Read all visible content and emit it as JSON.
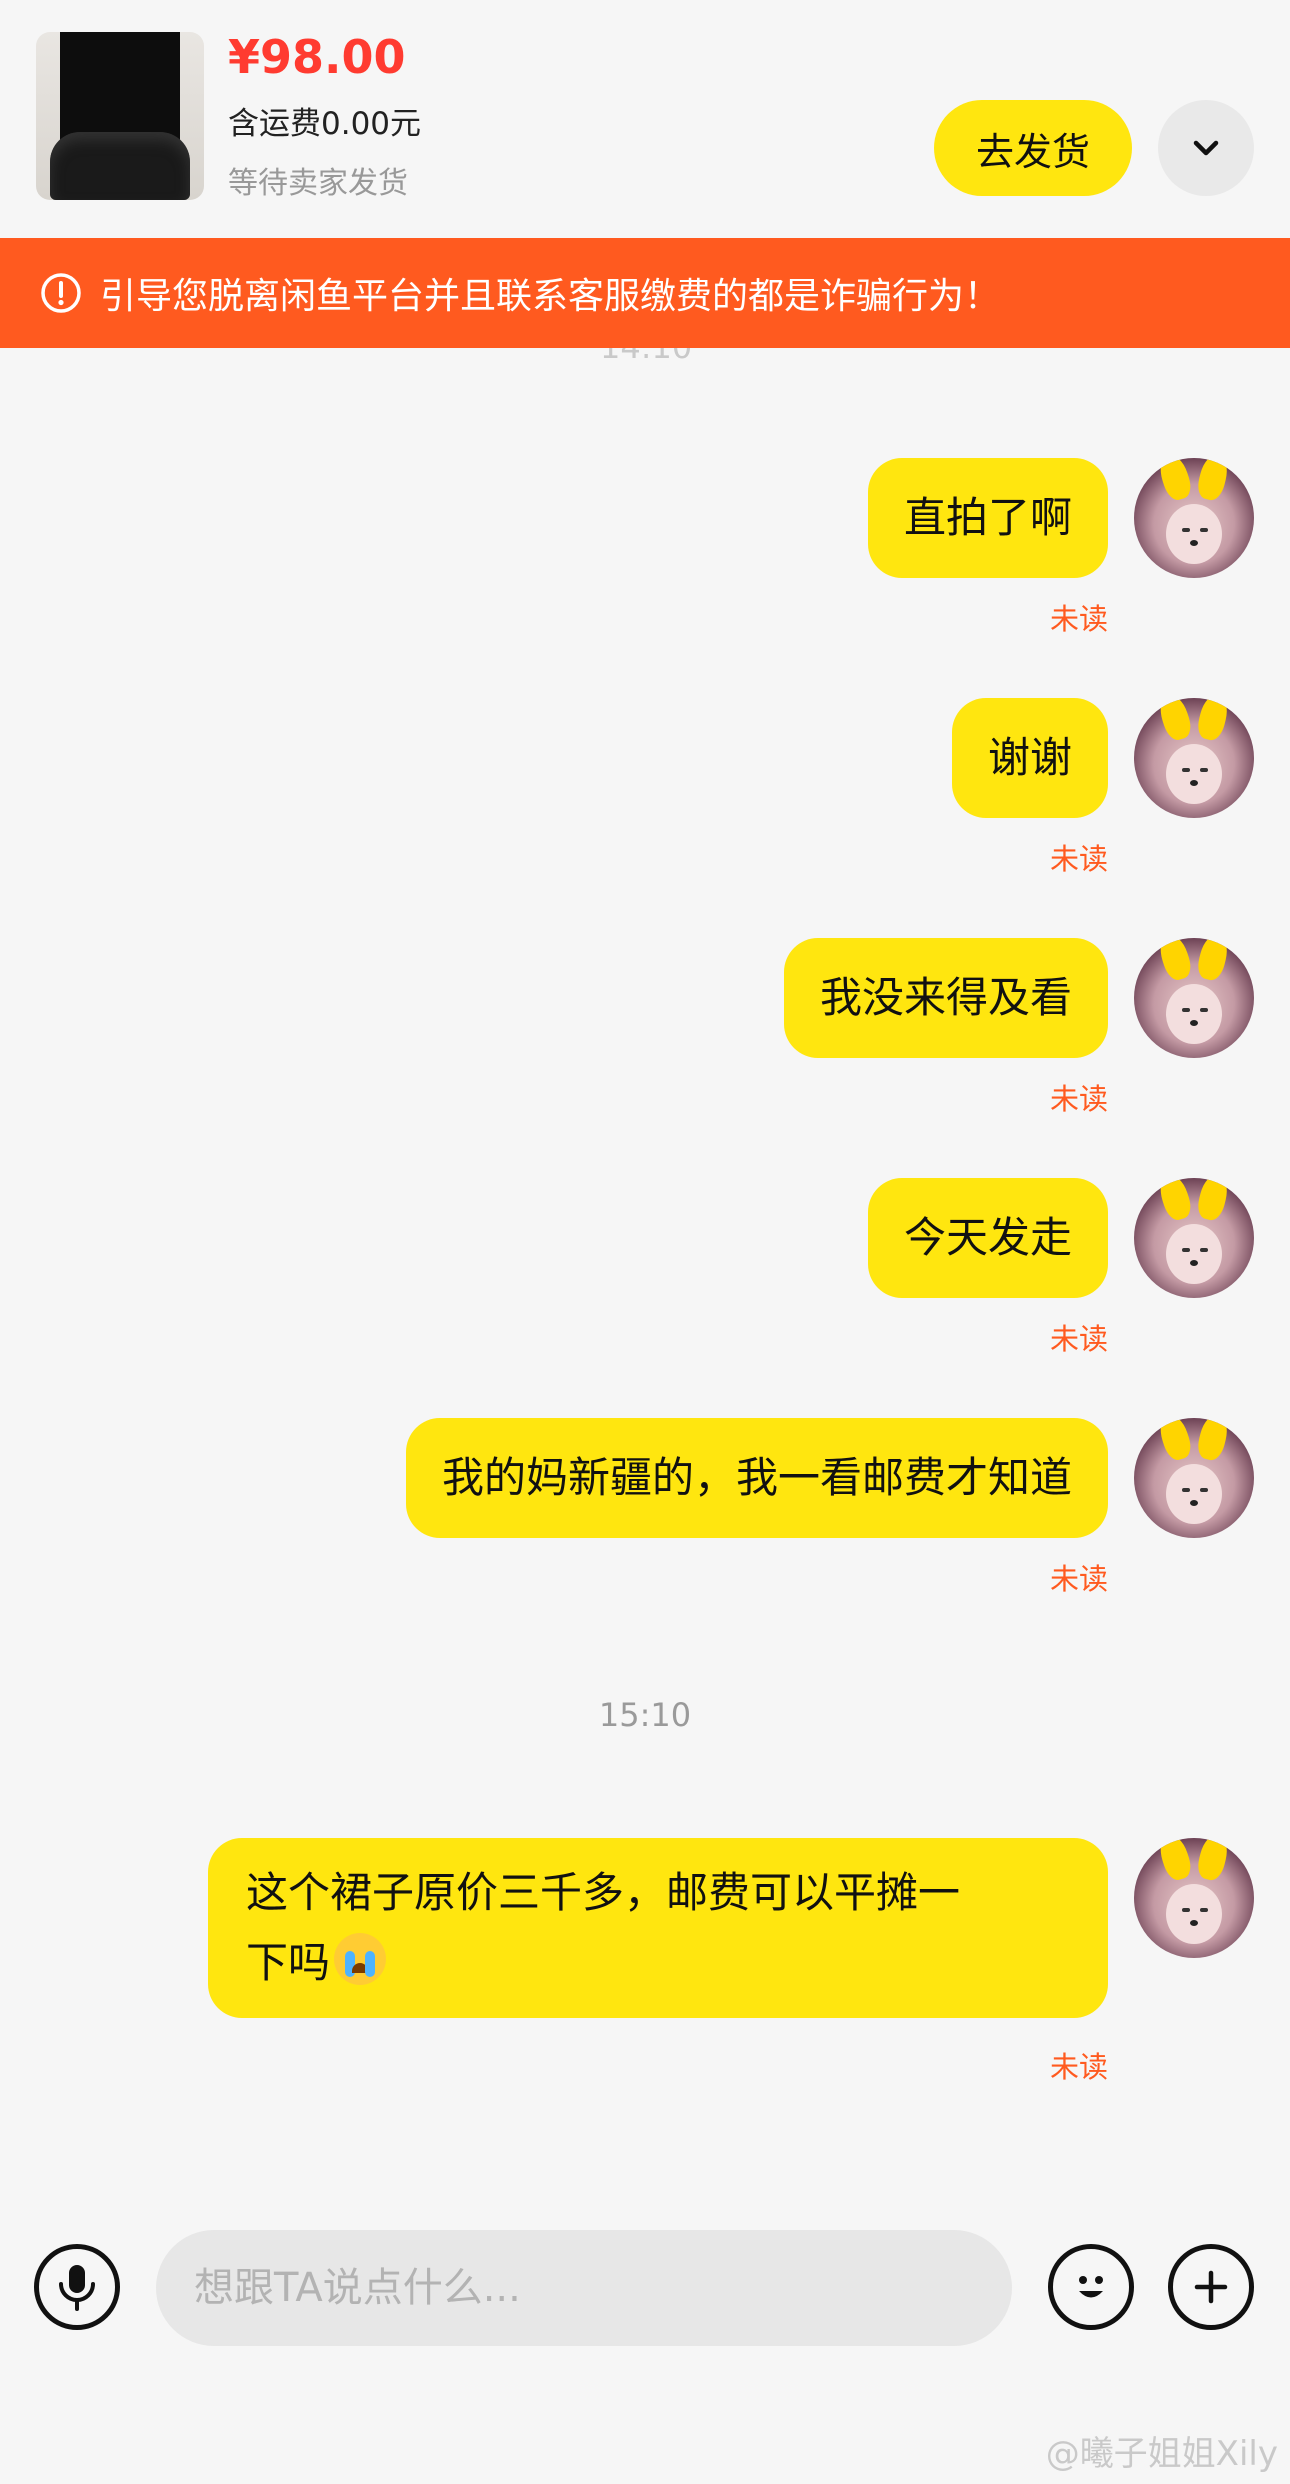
{
  "order": {
    "price": "¥98.00",
    "shipping": "含运费0.00元",
    "status": "等待卖家发货",
    "ship_button": "去发货"
  },
  "warning": "引导您脱离闲鱼平台并且联系客服缴费的都是诈骗行为！",
  "ghost_time": "14:10",
  "messages": [
    {
      "text": "直拍了啊",
      "status": "未读"
    },
    {
      "text": "谢谢",
      "status": "未读"
    },
    {
      "text": "我没来得及看",
      "status": "未读"
    },
    {
      "text": "今天发走",
      "status": "未读"
    },
    {
      "text": "我的妈新疆的，我一看邮费才知道",
      "status": "未读"
    },
    {
      "text": "这个裙子原价三千多，邮费可以平摊一",
      "text2": "下吗",
      "status": "未读"
    }
  ],
  "timestamp": "15:10",
  "input": {
    "placeholder": "想跟TA说点什么..."
  },
  "watermark": "@曦子姐姐Xily",
  "icons": {
    "expand": "chevron-down-icon",
    "warning": "exclamation-circle-icon",
    "mic": "microphone-icon",
    "emoji": "smiley-icon",
    "plus": "plus-icon",
    "cry": "crying-face-emoji"
  },
  "colors": {
    "accent_yellow": "#ffe60f",
    "warning_orange": "#ff5a1f",
    "price_red": "#ff3b30"
  }
}
